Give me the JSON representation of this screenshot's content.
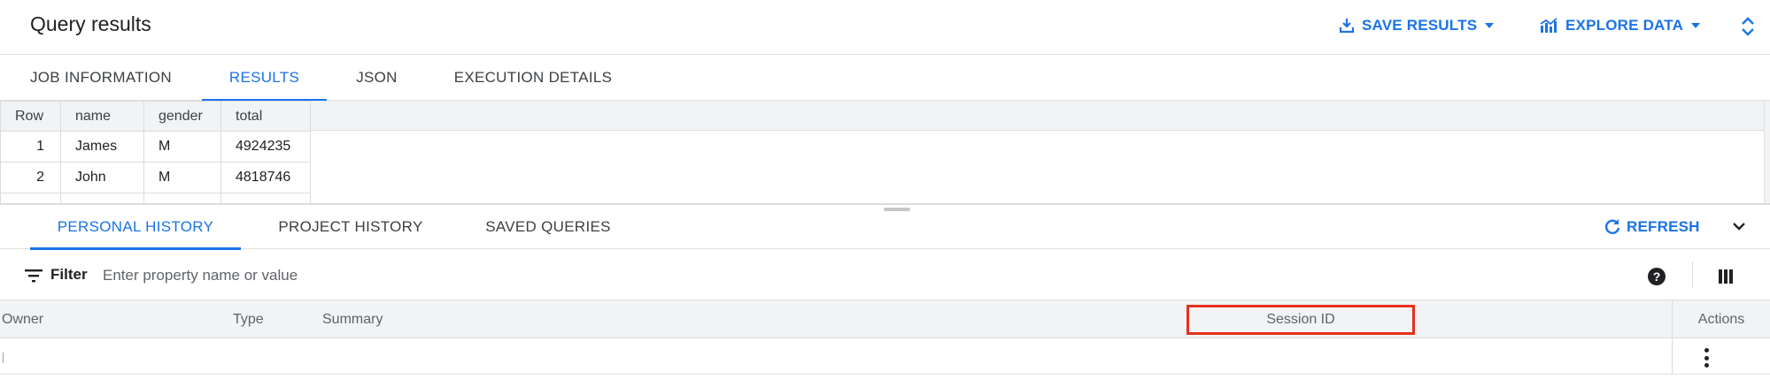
{
  "header": {
    "title": "Query results",
    "save_results": "SAVE RESULTS",
    "explore_data": "EXPLORE DATA"
  },
  "result_tabs": [
    {
      "label": "JOB INFORMATION",
      "active": false
    },
    {
      "label": "RESULTS",
      "active": true
    },
    {
      "label": "JSON",
      "active": false
    },
    {
      "label": "EXECUTION DETAILS",
      "active": false
    }
  ],
  "results_table": {
    "columns": [
      "Row",
      "name",
      "gender",
      "total"
    ],
    "rows": [
      [
        "1",
        "James",
        "M",
        "4924235"
      ],
      [
        "2",
        "John",
        "M",
        "4818746"
      ]
    ]
  },
  "history_tabs": [
    {
      "label": "PERSONAL HISTORY",
      "active": true
    },
    {
      "label": "PROJECT HISTORY",
      "active": false
    },
    {
      "label": "SAVED QUERIES",
      "active": false
    }
  ],
  "refresh_label": "REFRESH",
  "filter": {
    "label": "Filter",
    "placeholder": "Enter property name or value"
  },
  "history_table": {
    "columns": {
      "owner": "Owner",
      "type": "Type",
      "summary": "Summary",
      "session_id": "Session ID",
      "actions": "Actions"
    }
  },
  "colors": {
    "accent": "#1a73e8",
    "highlight": "#e8301e",
    "header_bg": "#f1f3f4"
  }
}
